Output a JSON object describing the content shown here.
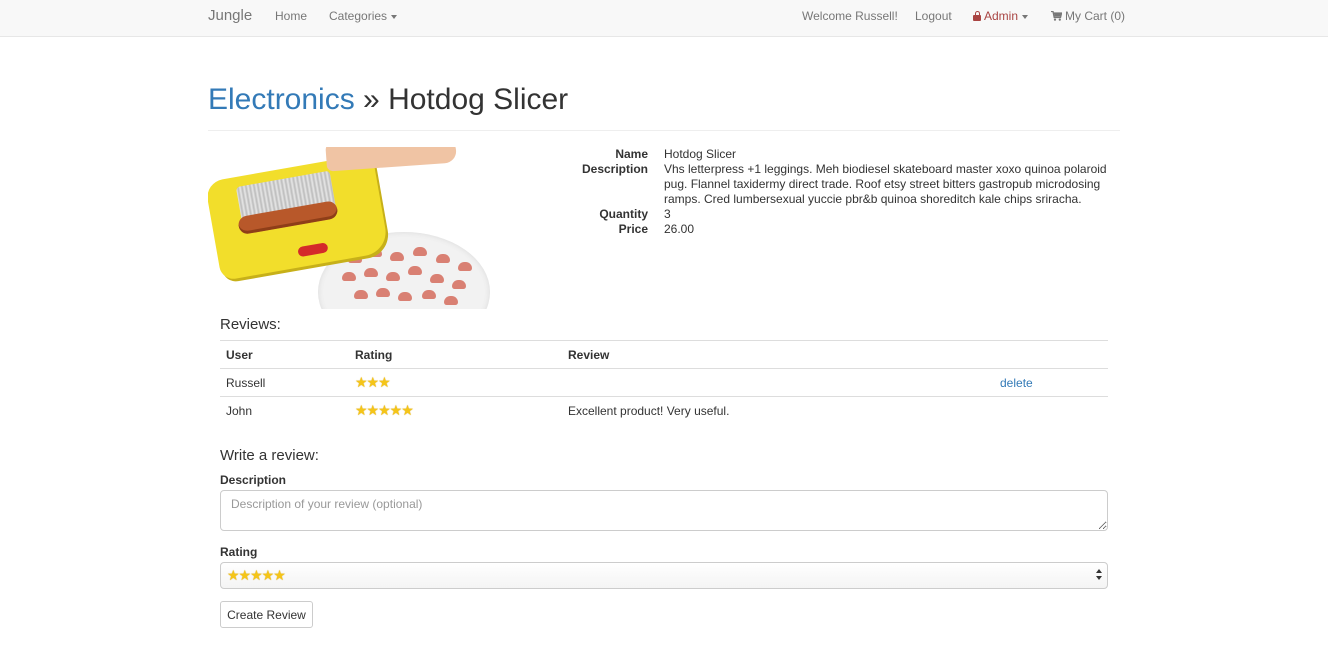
{
  "navbar": {
    "brand": "Jungle",
    "home": "Home",
    "categories": "Categories",
    "welcome": "Welcome Russell!",
    "logout": "Logout",
    "admin": "Admin",
    "cart": "My Cart (0)",
    "admin_color": "#a94442"
  },
  "page": {
    "category": "Electronics",
    "separator": " » ",
    "product_title": "Hotdog Slicer",
    "link_color": "#337ab7"
  },
  "details": {
    "name_label": "Name",
    "name_value": "Hotdog Slicer",
    "description_label": "Description",
    "description_value": "Vhs letterpress +1 leggings. Meh biodiesel skateboard master xoxo quinoa polaroid pug. Flannel taxidermy direct trade. Roof etsy street bitters gastropub microdosing ramps. Cred lumbersexual yuccie pbr&b quinoa shoreditch kale chips sriracha.",
    "quantity_label": "Quantity",
    "quantity_value": "3",
    "price_label": "Price",
    "price_value": "26.00"
  },
  "reviews": {
    "heading": "Reviews:",
    "columns": {
      "user": "User",
      "rating": "Rating",
      "review": "Review"
    },
    "rows": [
      {
        "user": "Russell",
        "rating": 3,
        "stars": "★★★",
        "review": "",
        "action": "delete"
      },
      {
        "user": "John",
        "rating": 5,
        "stars": "★★★★★",
        "review": "Excellent product! Very useful.",
        "action": ""
      }
    ]
  },
  "form": {
    "heading": "Write a review:",
    "description_label": "Description",
    "description_placeholder": "Description of your review (optional)",
    "description_value": "",
    "rating_label": "Rating",
    "rating_selected": "★★★★★",
    "rating_selected_value": 5,
    "submit_label": "Create Review"
  },
  "colors": {
    "star": "#f5c518"
  }
}
